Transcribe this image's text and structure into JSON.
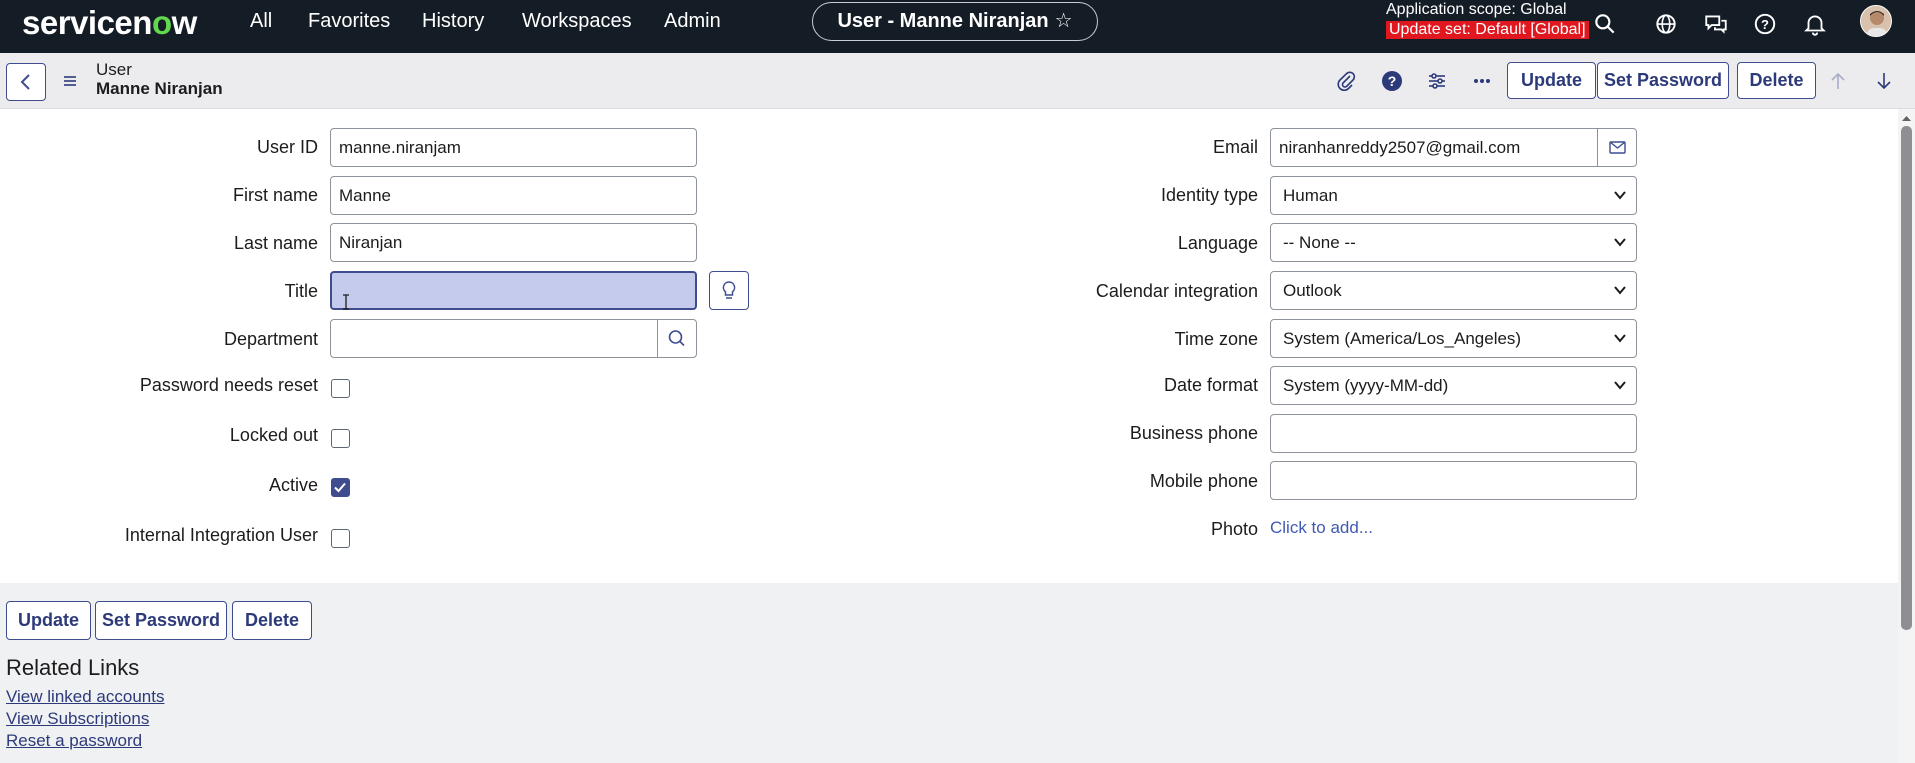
{
  "nav": {
    "logo_prefix": "servicen",
    "logo_o": "o",
    "logo_suffix": "w",
    "items": [
      "All",
      "Favorites",
      "History",
      "Workspaces",
      "Admin"
    ],
    "record_pill": "User - Manne Niranjan",
    "star": "☆",
    "app_scope": "Application scope: Global",
    "update_set": "Update set: Default [Global]"
  },
  "header": {
    "record_type": "User",
    "record_name": "Manne Niranjan",
    "buttons": {
      "update": "Update",
      "set_password": "Set Password",
      "delete": "Delete"
    }
  },
  "form": {
    "left": {
      "user_id": {
        "label": "User ID",
        "value": "manne.niranjam"
      },
      "first_name": {
        "label": "First name",
        "value": "Manne"
      },
      "last_name": {
        "label": "Last name",
        "value": "Niranjan"
      },
      "title": {
        "label": "Title",
        "value": ""
      },
      "department": {
        "label": "Department",
        "value": ""
      },
      "password_needs_reset": {
        "label": "Password needs reset",
        "checked": false
      },
      "locked_out": {
        "label": "Locked out",
        "checked": false
      },
      "active": {
        "label": "Active",
        "checked": true
      },
      "internal_integration_user": {
        "label": "Internal Integration User",
        "checked": false
      }
    },
    "right": {
      "email": {
        "label": "Email",
        "value": "niranhanreddy2507@gmail.com"
      },
      "identity_type": {
        "label": "Identity type",
        "value": "Human"
      },
      "language": {
        "label": "Language",
        "value": "-- None --"
      },
      "calendar_integration": {
        "label": "Calendar integration",
        "value": "Outlook"
      },
      "time_zone": {
        "label": "Time zone",
        "value": "System (America/Los_Angeles)"
      },
      "date_format": {
        "label": "Date format",
        "value": "System (yyyy-MM-dd)"
      },
      "business_phone": {
        "label": "Business phone",
        "value": ""
      },
      "mobile_phone": {
        "label": "Mobile phone",
        "value": ""
      },
      "photo": {
        "label": "Photo",
        "link": "Click to add..."
      }
    }
  },
  "footer": {
    "buttons": {
      "update": "Update",
      "set_password": "Set Password",
      "delete": "Delete"
    },
    "related_links_title": "Related Links",
    "links": [
      "View linked accounts",
      "View Subscriptions",
      "Reset a password"
    ]
  },
  "colors": {
    "nav_bg": "#141d26",
    "accent": "#3f4d8f",
    "update_set_bg": "#e0171f",
    "logo_green": "#62d84e"
  }
}
